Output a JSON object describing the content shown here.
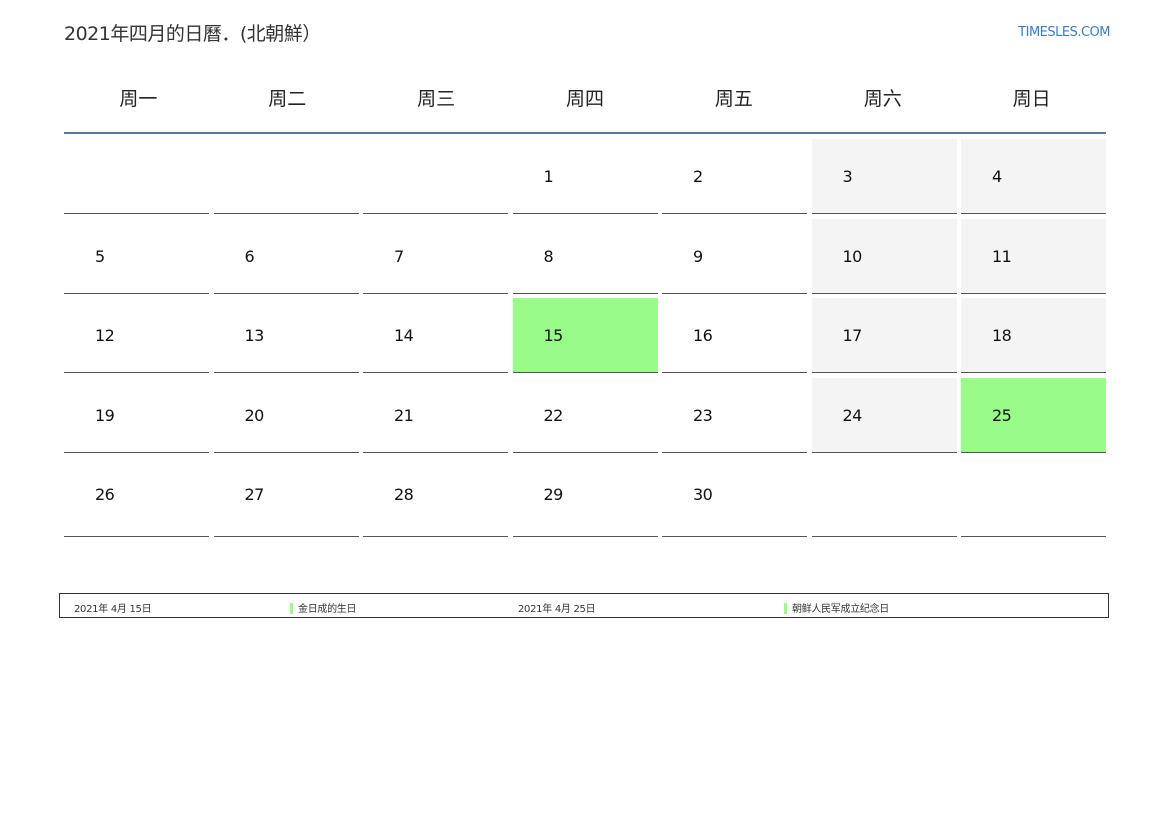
{
  "header": {
    "title": "2021年四月的日曆．(北朝鮮）",
    "site": "TIMESLES.COM"
  },
  "weekdays": [
    "周一",
    "周二",
    "周三",
    "周四",
    "周五",
    "周六",
    "周日"
  ],
  "colors": {
    "holiday": "#99fb88",
    "weekend": "#f4f4f4",
    "header_rule": "#5a7699",
    "site_link": "#3a7cc4"
  },
  "calendar": {
    "weeks": [
      [
        "",
        "",
        "",
        "1",
        "2",
        "3",
        "4"
      ],
      [
        "5",
        "6",
        "7",
        "8",
        "9",
        "10",
        "11"
      ],
      [
        "12",
        "13",
        "14",
        "15",
        "16",
        "17",
        "18"
      ],
      [
        "19",
        "20",
        "21",
        "22",
        "23",
        "24",
        "25"
      ],
      [
        "26",
        "27",
        "28",
        "29",
        "30",
        "",
        ""
      ]
    ],
    "holidays": [
      "15",
      "25"
    ]
  },
  "legend": [
    {
      "date": "2021年 4月 15日",
      "name": "金日成的生日"
    },
    {
      "date": "2021年 4月 25日",
      "name": "朝鲜人民军成立纪念日"
    }
  ]
}
